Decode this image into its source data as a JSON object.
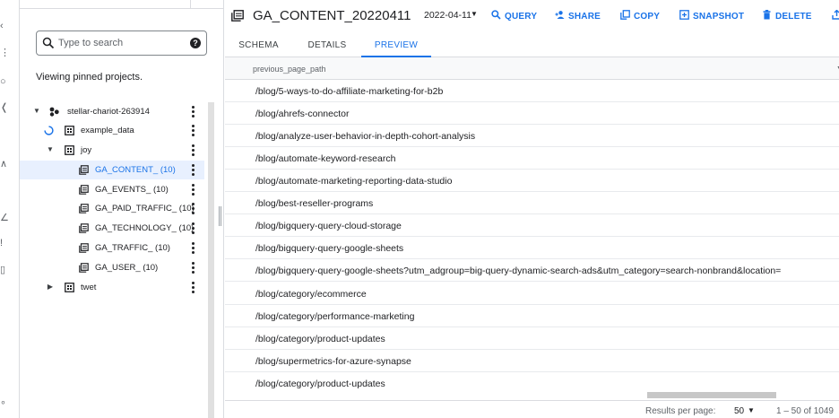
{
  "explorer": {
    "search_placeholder": "Type to search",
    "help_glyph": "?",
    "viewing_text": "Viewing pinned projects.",
    "tree": [
      {
        "label": "stellar-chariot-263914",
        "kind": "project"
      },
      {
        "label": "example_data",
        "kind": "dataset"
      },
      {
        "label": "joy",
        "kind": "dataset"
      },
      {
        "label": "GA_CONTENT_ (10)",
        "kind": "table",
        "selected": true
      },
      {
        "label": "GA_EVENTS_ (10)",
        "kind": "table"
      },
      {
        "label": "GA_PAID_TRAFFIC_ (10)",
        "kind": "table"
      },
      {
        "label": "GA_TECHNOLOGY_ (10)",
        "kind": "table"
      },
      {
        "label": "GA_TRAFFIC_ (10)",
        "kind": "table"
      },
      {
        "label": "GA_USER_ (10)",
        "kind": "table"
      },
      {
        "label": "twet",
        "kind": "dataset"
      }
    ]
  },
  "header": {
    "title": "GA_CONTENT_20220411",
    "date": "2022-04-11",
    "actions": {
      "query": "QUERY",
      "share": "SHARE",
      "copy": "COPY",
      "snapshot": "SNAPSHOT",
      "delete": "DELETE"
    }
  },
  "tabs": {
    "schema": "SCHEMA",
    "details": "DETAILS",
    "preview": "PREVIEW",
    "active": "preview"
  },
  "table": {
    "column": "previous_page_path",
    "rows": [
      "/blog/5-ways-to-do-affiliate-marketing-for-b2b",
      "/blog/ahrefs-connector",
      "/blog/analyze-user-behavior-in-depth-cohort-analysis",
      "/blog/automate-keyword-research",
      "/blog/automate-marketing-reporting-data-studio",
      "/blog/best-reseller-programs",
      "/blog/bigquery-query-cloud-storage",
      "/blog/bigquery-query-google-sheets",
      "/blog/bigquery-query-google-sheets?utm_adgroup=big-query-dynamic-search-ads&utm_category=search-nonbrand&location=",
      "/blog/category/ecommerce",
      "/blog/category/performance-marketing",
      "/blog/category/product-updates",
      "/blog/supermetrics-for-azure-synapse",
      "/blog/category/product-updates"
    ]
  },
  "footer": {
    "results_per_page_label": "Results per page:",
    "results_per_page_value": "50",
    "range": "1 – 50 of 1049"
  },
  "colors": {
    "accent": "#1a73e8",
    "selected_bg": "#e8f0fe",
    "border": "#dadce0"
  }
}
